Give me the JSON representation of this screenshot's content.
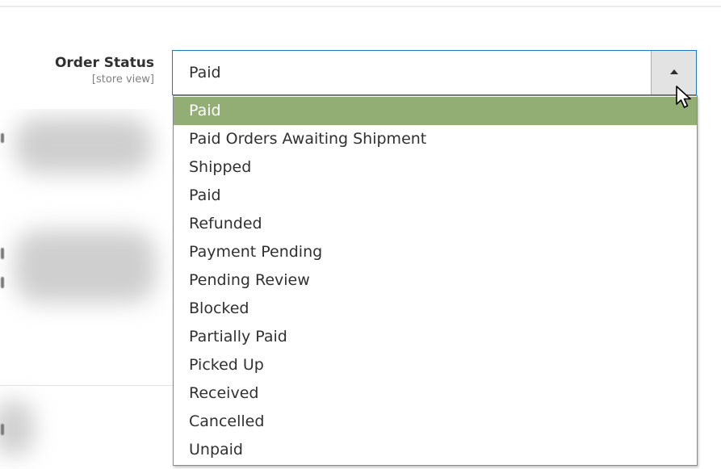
{
  "field": {
    "label": "Order Status",
    "scope": "[store view]",
    "selected_value": "Paid"
  },
  "dropdown": {
    "selected_index": 0,
    "options": [
      "Paid",
      "Paid Orders Awaiting Shipment",
      "Shipped",
      "Paid",
      "Refunded",
      "Payment Pending",
      "Pending Review",
      "Blocked",
      "Partially Paid",
      "Picked Up",
      "Received",
      "Cancelled",
      "Unpaid"
    ]
  },
  "colors": {
    "focus_border": "#1979c3",
    "option_highlight": "#92ae74"
  },
  "icons": {
    "arrow": "triangle-up-icon",
    "cursor": "mouse-pointer-icon"
  }
}
